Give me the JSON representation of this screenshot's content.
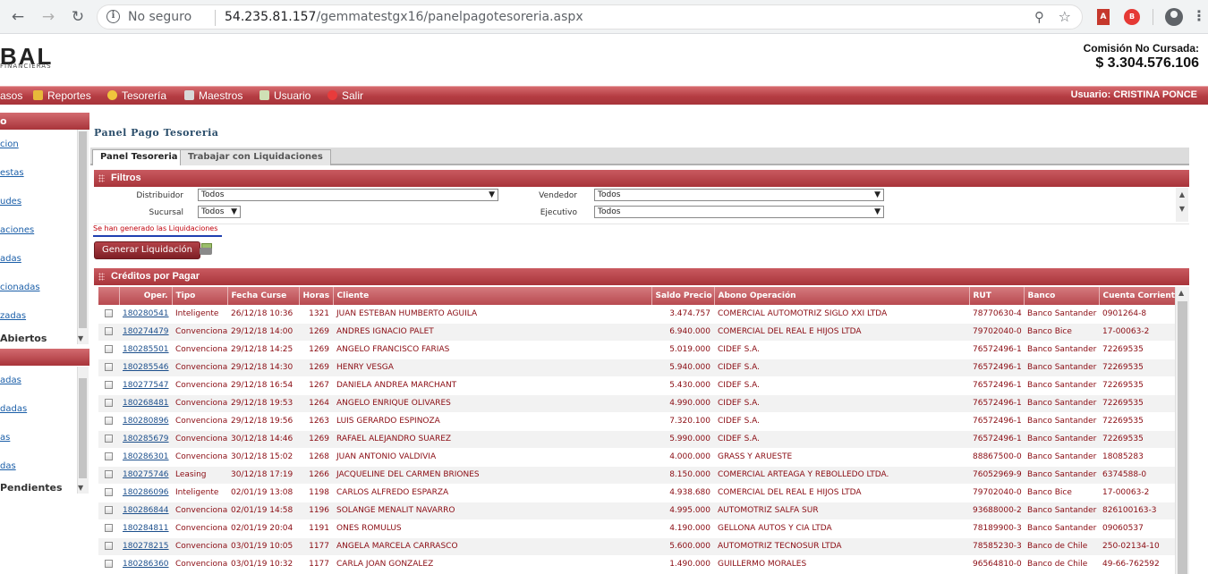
{
  "browser": {
    "security": "No seguro",
    "url_host": "54.235.81.157",
    "url_path": "/gemmatestgx16/panelpagotesoreria.aspx"
  },
  "header": {
    "logo": "BAL",
    "logo_sub": "FINANCIERAS",
    "comision_label": "Comisión No Cursada:",
    "comision_value": "$ 3.304.576.106"
  },
  "menu": {
    "items": [
      "asos",
      "Reportes",
      "Tesorería",
      "Maestros",
      "Usuario",
      "Salir"
    ],
    "user": "Usuario:  CRISTINA PONCE"
  },
  "sidebar": {
    "head1": "o",
    "links1": [
      "cion",
      "estas",
      "udes",
      "aciones",
      "adas",
      "cionadas",
      "zadas"
    ],
    "section1": "Abiertos",
    "links2": [
      "adas",
      "dadas",
      "as",
      "das"
    ],
    "section2": "Pendientes"
  },
  "panel": {
    "title": "Panel Pago Tesoreria",
    "tabs": [
      "Panel Tesoreria",
      "Trabajar con Liquidaciones"
    ],
    "filtros_title": "Filtros",
    "filters": {
      "distribuidor_label": "Distribuidor",
      "distribuidor_value": "Todos",
      "sucursal_label": "Sucursal",
      "sucursal_value": "Todos",
      "vendedor_label": "Vendedor",
      "vendedor_value": "Todos",
      "ejecutivo_label": "Ejecutivo",
      "ejecutivo_value": "Todos"
    },
    "message": "Se han generado las Liquidaciones",
    "generate_button": "Generar Liquidación",
    "creditos_title": "Créditos por Pagar"
  },
  "table": {
    "columns": [
      "",
      "Oper.",
      "Tipo",
      "Fecha Curse",
      "Horas",
      "Cliente",
      "Saldo Precio",
      "Abono Operación",
      "RUT",
      "Banco",
      "Cuenta Corriente"
    ],
    "rows": [
      [
        "180280541",
        "Inteligente",
        "26/12/18 10:36",
        "1321",
        "JUAN ESTEBAN HUMBERTO AGUILA",
        "3.474.757",
        "COMERCIAL AUTOMOTRIZ SIGLO XXI LTDA",
        "78770630-4",
        "Banco Santander",
        "0901264-8"
      ],
      [
        "180274479",
        "Convencional",
        "29/12/18 14:00",
        "1269",
        "ANDRES IGNACIO PALET",
        "6.940.000",
        "COMERCIAL DEL REAL E HIJOS LTDA",
        "79702040-0",
        "Banco Bice",
        "17-00063-2"
      ],
      [
        "180285501",
        "Convencional",
        "29/12/18 14:25",
        "1269",
        "ANGELO FRANCISCO FARIAS",
        "5.019.000",
        "CIDEF S.A.",
        "76572496-1",
        "Banco Santander",
        "72269535"
      ],
      [
        "180285546",
        "Convencional",
        "29/12/18 14:30",
        "1269",
        "HENRY VESGA",
        "5.940.000",
        "CIDEF S.A.",
        "76572496-1",
        "Banco Santander",
        "72269535"
      ],
      [
        "180277547",
        "Convencional",
        "29/12/18 16:54",
        "1267",
        "DANIELA ANDREA MARCHANT",
        "5.430.000",
        "CIDEF S.A.",
        "76572496-1",
        "Banco Santander",
        "72269535"
      ],
      [
        "180268481",
        "Convencional",
        "29/12/18 19:53",
        "1264",
        "ANGELO ENRIQUE OLIVARES",
        "4.990.000",
        "CIDEF S.A.",
        "76572496-1",
        "Banco Santander",
        "72269535"
      ],
      [
        "180280896",
        "Convencional",
        "29/12/18 19:56",
        "1263",
        "LUIS GERARDO ESPINOZA",
        "7.320.100",
        "CIDEF S.A.",
        "76572496-1",
        "Banco Santander",
        "72269535"
      ],
      [
        "180285679",
        "Convencional",
        "30/12/18 14:46",
        "1269",
        "RAFAEL ALEJANDRO SUAREZ",
        "5.990.000",
        "CIDEF S.A.",
        "76572496-1",
        "Banco Santander",
        "72269535"
      ],
      [
        "180286301",
        "Convencional",
        "30/12/18 15:02",
        "1268",
        "JUAN ANTONIO VALDIVIA",
        "4.000.000",
        "GRASS Y ARUESTE",
        "88867500-0",
        "Banco Santander",
        "18085283"
      ],
      [
        "180275746",
        "Leasing",
        "30/12/18 17:19",
        "1266",
        "JACQUELINE DEL CARMEN BRIONES",
        "8.150.000",
        "COMERCIAL ARTEAGA Y REBOLLEDO LTDA.",
        "76052969-9",
        "Banco Santander",
        "6374588-0"
      ],
      [
        "180286096",
        "Inteligente",
        "02/01/19 13:08",
        "1198",
        "CARLOS ALFREDO ESPARZA",
        "4.938.680",
        "COMERCIAL DEL REAL E HIJOS LTDA",
        "79702040-0",
        "Banco Bice",
        "17-00063-2"
      ],
      [
        "180286844",
        "Convencional",
        "02/01/19 14:58",
        "1196",
        "SOLANGE MENALIT NAVARRO",
        "4.995.000",
        "AUTOMOTRIZ SALFA SUR",
        "93688000-2",
        "Banco Santander",
        "826100163-3"
      ],
      [
        "180284811",
        "Convencional",
        "02/01/19 20:04",
        "1191",
        "ONES ROMULUS",
        "4.190.000",
        "GELLONA AUTOS Y CIA LTDA",
        "78189900-3",
        "Banco Santander",
        "09060537"
      ],
      [
        "180278215",
        "Convencional",
        "03/01/19 10:05",
        "1177",
        "ANGELA MARCELA CARRASCO",
        "5.600.000",
        "AUTOMOTRIZ TECNOSUR LTDA",
        "78585230-3",
        "Banco de Chile",
        "250-02134-10"
      ],
      [
        "180286360",
        "Convencional",
        "03/01/19 10:32",
        "1177",
        "CARLA JOAN GONZALEZ",
        "1.490.000",
        "GUILLERMO MORALES",
        "96564810-0",
        "Banco de Chile",
        "49-66-762592"
      ]
    ]
  }
}
